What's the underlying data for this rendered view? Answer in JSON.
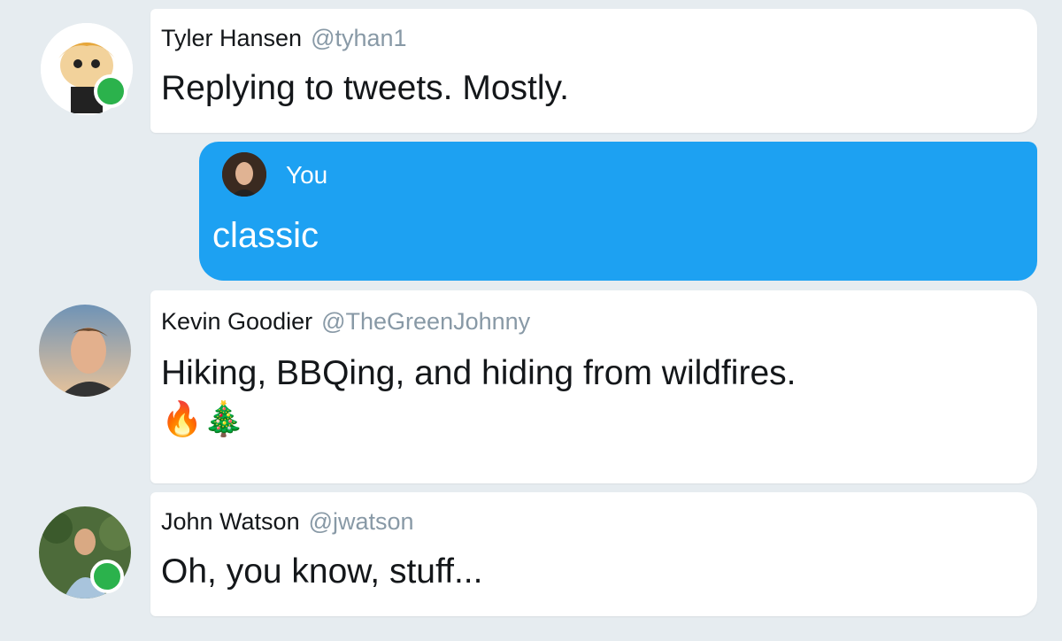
{
  "messages": [
    {
      "type": "incoming",
      "name": "Tyler Hansen",
      "handle": "@tyhan1",
      "text": "Replying to tweets. Mostly.",
      "online": true,
      "avatar": "south-park-style-cartoon-avatar"
    },
    {
      "type": "outgoing",
      "sender": "You",
      "text": "classic",
      "avatar": "user-photo-avatar"
    },
    {
      "type": "incoming",
      "name": "Kevin Goodier",
      "handle": "@TheGreenJohnny",
      "text": "Hiking, BBQing, and hiding from wildfires.",
      "emojis": "🔥🎄",
      "online": false,
      "avatar": "man-photo-avatar"
    },
    {
      "type": "incoming",
      "name": "John Watson",
      "handle": "@jwatson",
      "text": "Oh, you know, stuff...",
      "online": true,
      "avatar": "man-in-greenery-photo-avatar"
    }
  ],
  "colors": {
    "background": "#e6ecf0",
    "outgoing_bubble": "#1da1f2",
    "incoming_bubble": "#ffffff",
    "presence": "#2bb24c",
    "handle_text": "#8899a6"
  }
}
